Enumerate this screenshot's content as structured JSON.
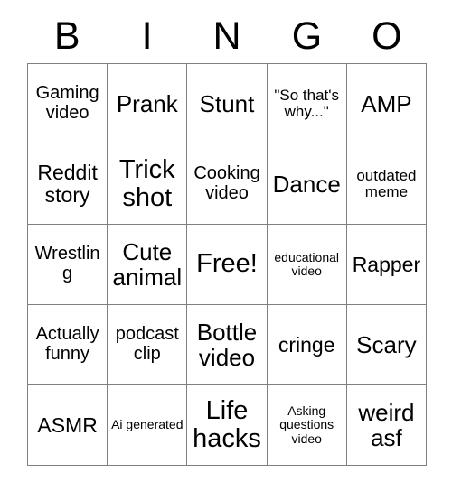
{
  "card": {
    "header_letters": [
      "B",
      "I",
      "N",
      "G",
      "O"
    ],
    "rows": [
      [
        {
          "text": "Gaming video",
          "size": "md"
        },
        {
          "text": "Prank",
          "size": "xl"
        },
        {
          "text": "Stunt",
          "size": "xl"
        },
        {
          "text": "\"So that's why...\"",
          "size": "sm"
        },
        {
          "text": "AMP",
          "size": "xl"
        }
      ],
      [
        {
          "text": "Reddit story",
          "size": "lg"
        },
        {
          "text": "Trick shot",
          "size": "xxl"
        },
        {
          "text": "Cooking video",
          "size": "md"
        },
        {
          "text": "Dance",
          "size": "xl"
        },
        {
          "text": "outdated meme",
          "size": "sm"
        }
      ],
      [
        {
          "text": "Wrestling",
          "size": "md"
        },
        {
          "text": "Cute animal",
          "size": "xl"
        },
        {
          "text": "Free!",
          "size": "xxl"
        },
        {
          "text": "educational video",
          "size": "xs"
        },
        {
          "text": "Rapper",
          "size": "lg"
        }
      ],
      [
        {
          "text": "Actually funny",
          "size": "md"
        },
        {
          "text": "podcast clip",
          "size": "md"
        },
        {
          "text": "Bottle video",
          "size": "xl"
        },
        {
          "text": "cringe",
          "size": "lg"
        },
        {
          "text": "Scary",
          "size": "xl"
        }
      ],
      [
        {
          "text": "ASMR",
          "size": "lg"
        },
        {
          "text": "Ai generated",
          "size": "xs"
        },
        {
          "text": "Life hacks",
          "size": "xxl"
        },
        {
          "text": "Asking questions video",
          "size": "xs"
        },
        {
          "text": "weird asf",
          "size": "xl"
        }
      ]
    ]
  }
}
